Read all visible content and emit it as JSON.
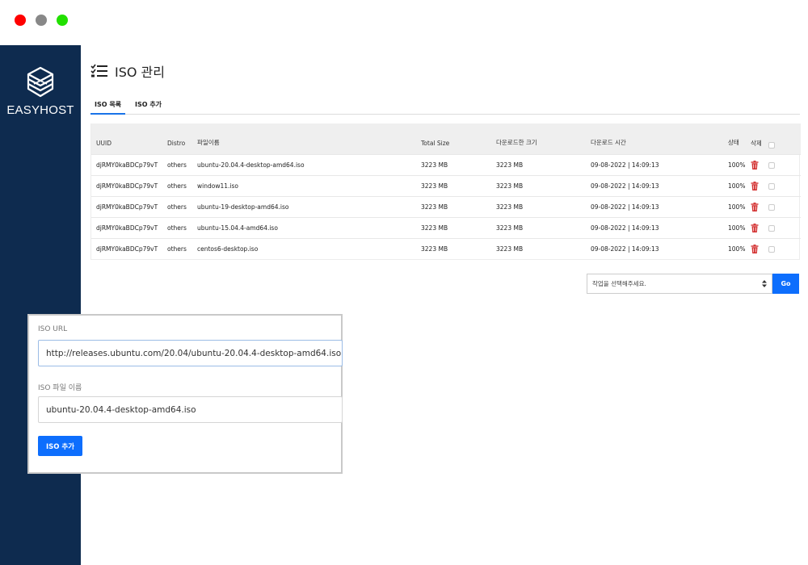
{
  "colors": {
    "sidebar": "#0e2b4f",
    "accent": "#0d6efd",
    "delete": "#d32f2f",
    "window_close": "#ff0000",
    "window_min": "#888888",
    "window_max": "#22e000"
  },
  "sidebar": {
    "brand": "EASYHOST",
    "logo_icon": "layered-cube-icon"
  },
  "header": {
    "title": "ISO 관리",
    "title_icon": "checklist-icon"
  },
  "tabs": [
    {
      "label": "ISO 목록",
      "active": true
    },
    {
      "label": "ISO 추가",
      "active": false
    }
  ],
  "table": {
    "headers": {
      "uuid": "UUID",
      "distro": "Distro",
      "filename": "파일이름",
      "total_size": "Total Size",
      "downloaded_size": "다운로드한 크기",
      "download_time": "다운로드 시간",
      "status": "상태",
      "delete": "삭제"
    },
    "rows": [
      {
        "uuid": "djRMY0kaBDCp79vT",
        "distro": "others",
        "filename": "ubuntu-20.04.4-desktop-amd64.iso",
        "total_size": "3223 MB",
        "downloaded_size": "3223 MB",
        "download_time": "09-08-2022 | 14:09:13",
        "status": "100%"
      },
      {
        "uuid": "djRMY0kaBDCp79vT",
        "distro": "others",
        "filename": "window11.iso",
        "total_size": "3223 MB",
        "downloaded_size": "3223 MB",
        "download_time": "09-08-2022 | 14:09:13",
        "status": "100%"
      },
      {
        "uuid": "djRMY0kaBDCp79vT",
        "distro": "others",
        "filename": "ubuntu-19-desktop-amd64.iso",
        "total_size": "3223 MB",
        "downloaded_size": "3223 MB",
        "download_time": "09-08-2022 | 14:09:13",
        "status": "100%"
      },
      {
        "uuid": "djRMY0kaBDCp79vT",
        "distro": "others",
        "filename": "ubuntu-15.04.4-amd64.iso",
        "total_size": "3223 MB",
        "downloaded_size": "3223 MB",
        "download_time": "09-08-2022 | 14:09:13",
        "status": "100%"
      },
      {
        "uuid": "djRMY0kaBDCp79vT",
        "distro": "others",
        "filename": "centos6-desktop.iso",
        "total_size": "3223 MB",
        "downloaded_size": "3223 MB",
        "download_time": "09-08-2022 | 14:09:13",
        "status": "100%"
      }
    ]
  },
  "actions": {
    "select_placeholder": "작업을 선택해주세요.",
    "go_label": "Go"
  },
  "form": {
    "url_label": "ISO URL",
    "url_value": "http://releases.ubuntu.com/20.04/ubuntu-20.04.4-desktop-amd64.iso",
    "filename_label": "ISO 파일 이름",
    "filename_value": "ubuntu-20.04.4-desktop-amd64.iso",
    "submit_label": "ISO 추가"
  }
}
